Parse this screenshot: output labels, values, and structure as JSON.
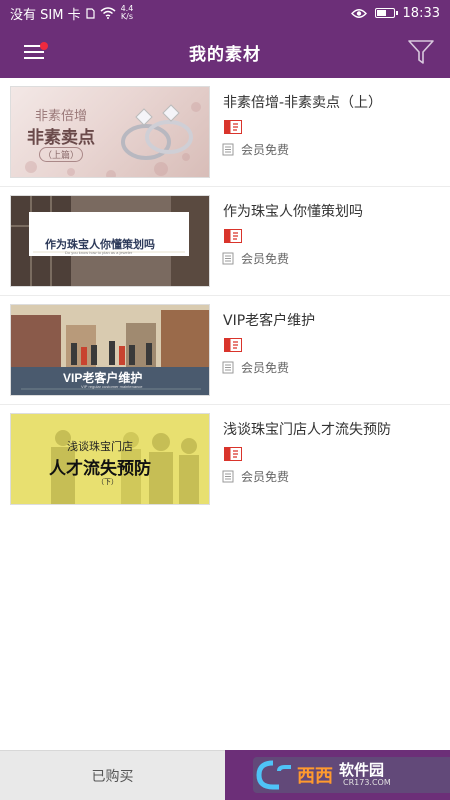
{
  "status_bar": {
    "carrier": "没有 SIM 卡",
    "speed_value": "4.4",
    "speed_unit": "K/s",
    "time": "18:33",
    "battery_level": 0.5
  },
  "header": {
    "title": "我的素材",
    "menu_icon": "hamburger-menu-icon",
    "filter_icon": "filter-funnel-icon"
  },
  "items": [
    {
      "title": "非素倍增-非素卖点（上）",
      "thumb_line1": "非素倍增",
      "thumb_line2": "非素卖点",
      "thumb_tag": "（上篇）",
      "price": "会员免费"
    },
    {
      "title": "作为珠宝人你懂策划吗",
      "thumb_line1": "作为珠宝人你懂策划吗",
      "thumb_line2": "Do you know how to plan as a jeweler",
      "price": "会员免费"
    },
    {
      "title": "VIP老客户维护",
      "thumb_line1": "VIP老客户维护",
      "thumb_line2": "VIP regular customer maintenance",
      "price": "会员免费"
    },
    {
      "title": "浅谈珠宝门店人才流失预防",
      "thumb_line1": "浅谈珠宝门店",
      "thumb_line2": "人才流失预防",
      "thumb_tag": "（下）",
      "price": "会员免费"
    }
  ],
  "bottom_bar": {
    "purchased_label": "已购买",
    "watermark_brand": "西西",
    "watermark_site": "软件园",
    "watermark_url": "CR173.COM"
  },
  "colors": {
    "brand_purple": "#6c2f78",
    "pdf_red": "#d9342b",
    "badge_red": "#f0293e"
  }
}
